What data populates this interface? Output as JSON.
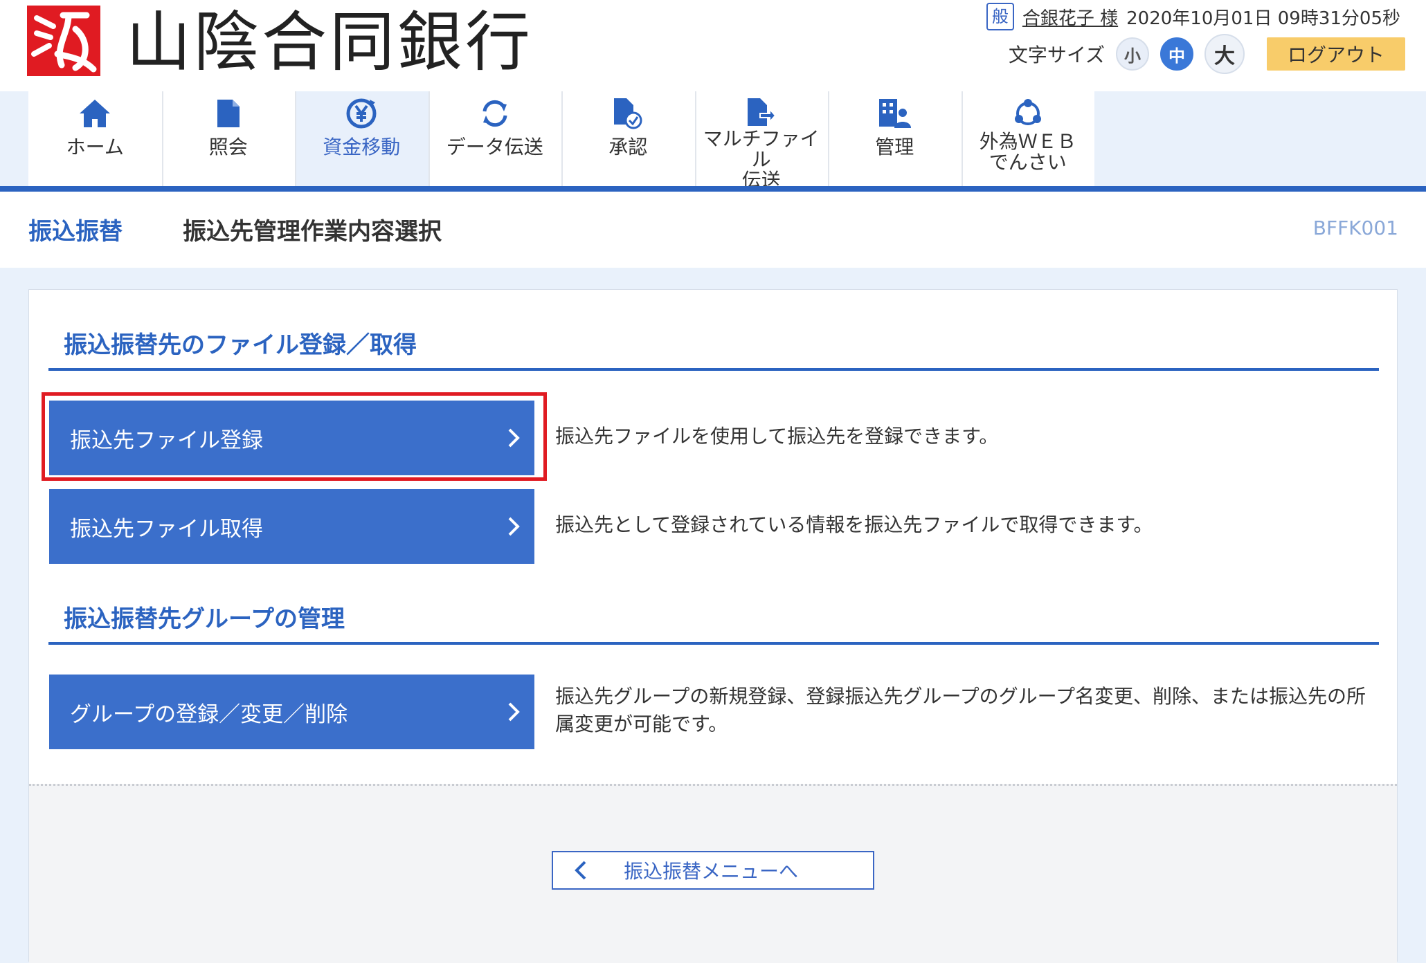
{
  "header": {
    "bank_name": "山陰合同銀行",
    "user_badge": "般",
    "user_name": "合銀花子 様",
    "datetime": "2020年10月01日 09時31分05秒",
    "font_size_label": "文字サイズ",
    "font_sizes": [
      "小",
      "中",
      "大"
    ],
    "logout_label": "ログアウト"
  },
  "nav": {
    "items": [
      {
        "label": "ホーム",
        "icon": "home-icon"
      },
      {
        "label": "照会",
        "icon": "document-icon"
      },
      {
        "label": "資金移動",
        "icon": "yen-transfer-icon"
      },
      {
        "label": "データ伝送",
        "icon": "sync-icon"
      },
      {
        "label": "承認",
        "icon": "approve-document-icon"
      },
      {
        "label": "マルチファイル\n伝送",
        "icon": "file-transfer-icon"
      },
      {
        "label": "管理",
        "icon": "admin-icon"
      },
      {
        "label": "外為ＷＥＢ\nでんさい",
        "icon": "exchange-cycle-icon"
      }
    ],
    "active_index": 2
  },
  "title": {
    "crumb": "振込振替",
    "page_title": "振込先管理作業内容選択",
    "screen_id": "BFFK001"
  },
  "sections": {
    "file": {
      "heading": "振込振替先のファイル登録／取得",
      "register_label": "振込先ファイル登録",
      "register_desc": "振込先ファイルを使用して振込先を登録できます。",
      "get_label": "振込先ファイル取得",
      "get_desc": "振込先として登録されている情報を振込先ファイルで取得できます。"
    },
    "group": {
      "heading": "振込振替先グループの管理",
      "manage_label": "グループの登録／変更／削除",
      "manage_desc": "振込先グループの新規登録、登録振込先グループのグループ名変更、削除、または振込先の所属変更が可能です。"
    }
  },
  "footer": {
    "back_label": "振込振替メニューへ"
  },
  "colors": {
    "primary": "#2b63c0",
    "button": "#3b6fcb",
    "logout": "#f8cc6a",
    "highlight": "#e01b22"
  }
}
